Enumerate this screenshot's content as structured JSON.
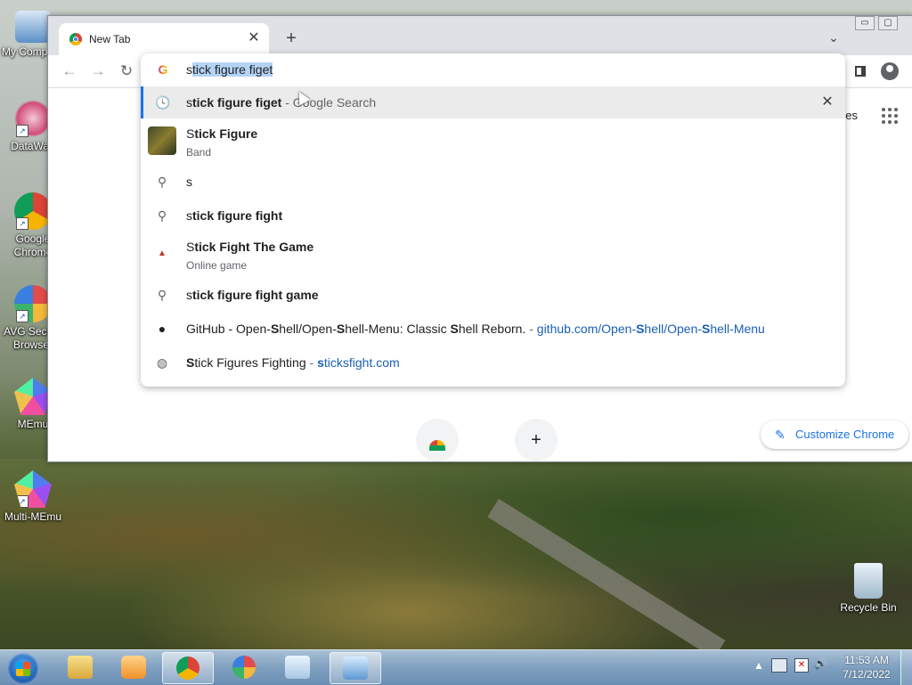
{
  "desktop": {
    "icons": [
      {
        "name": "my-computer",
        "label": "My Comp"
      },
      {
        "name": "datawag",
        "label": "DataWag"
      },
      {
        "name": "google-chrome",
        "label": "Google Chrome"
      },
      {
        "name": "avg-secure-browser",
        "label": "AVG Secure Browser"
      },
      {
        "name": "memu",
        "label": "MEmu"
      },
      {
        "name": "multi-memu",
        "label": "Multi-MEmu"
      },
      {
        "name": "recycle-bin",
        "label": "Recycle Bin"
      }
    ]
  },
  "browser": {
    "tab": {
      "title": "New Tab",
      "close": "✕"
    },
    "new_tab": "+",
    "tab_search": "⌄",
    "window_controls": {
      "minimize": "▭",
      "maximize": "▢"
    },
    "nav": {
      "back": "←",
      "forward": "→",
      "reload": "↻"
    },
    "page": {
      "images_link": "ges",
      "customize_label": "Customize Chrome",
      "customize_icon": "✎",
      "add_shortcut": "+"
    },
    "omnibox": {
      "g_icon": "G",
      "first_char": "s",
      "selected_text": "tick figure figet",
      "suggestions": [
        {
          "type": "history",
          "icon": "history-icon",
          "bold": "tick figure figet",
          "prefix": "s",
          "suffix": " - Google Search",
          "delete": "✕"
        },
        {
          "type": "entity",
          "prefix": "S",
          "bold": "tick Figure",
          "sub": "Band"
        },
        {
          "type": "search",
          "text": "s"
        },
        {
          "type": "search",
          "prefix": "s",
          "bold": "tick figure fight"
        },
        {
          "type": "entity",
          "prefix": "S",
          "bold": "tick Fight The Game",
          "sub": "Online game"
        },
        {
          "type": "search",
          "prefix": "s",
          "bold": "tick figure fight game"
        },
        {
          "type": "nav",
          "text_parts": [
            "GitHub - Open-",
            "S",
            "hell/Open-",
            "S",
            "hell-Menu: Classic ",
            "S",
            "hell Reborn."
          ],
          "sep": " - ",
          "url_parts": [
            "github.com/Open-",
            "S",
            "hell/Open-",
            "S",
            "hell-Menu"
          ]
        },
        {
          "type": "nav",
          "text_parts": [
            "S",
            "tick Figures Fighting"
          ],
          "sep": " - ",
          "url_parts": [
            "s",
            "ticksfight.com"
          ]
        }
      ]
    }
  },
  "taskbar": {
    "clock_time": "11:53 AM",
    "clock_date": "7/12/2022",
    "tray_arrow": "▲",
    "volume": "🔊"
  },
  "colors": {
    "accent": "#1a73e8",
    "selection": "#b4d3f5",
    "highlight_row": "#ebebeb"
  }
}
